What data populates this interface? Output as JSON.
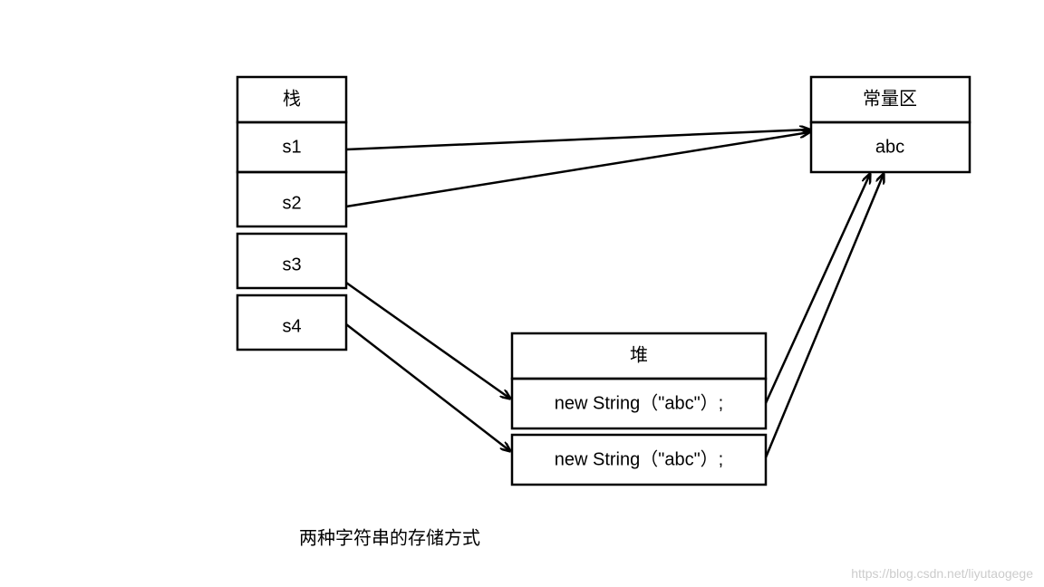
{
  "stack": {
    "title": "栈",
    "items": [
      "s1",
      "s2",
      "s3",
      "s4"
    ]
  },
  "heap": {
    "title": "堆",
    "items": [
      "new String（\"abc\"）;",
      "new String（\"abc\"）;"
    ]
  },
  "const_pool": {
    "title": "常量区",
    "items": [
      "abc"
    ]
  },
  "caption": "两种字符串的存储方式",
  "watermark": "https://blog.csdn.net/liyutaogege"
}
